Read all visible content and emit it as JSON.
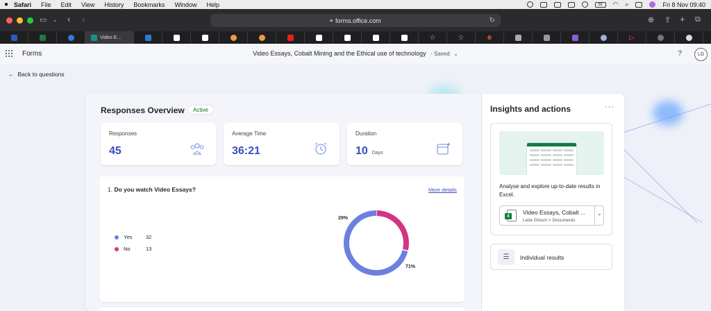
{
  "menubar": {
    "apple": "",
    "items": [
      "Safari",
      "File",
      "Edit",
      "View",
      "History",
      "Bookmarks",
      "Window",
      "Help"
    ],
    "datetime": "Fri 8 Nov 09:40",
    "battery": "50"
  },
  "browser": {
    "url": "forms.office.com",
    "active_tab_title": "Video E..."
  },
  "app": {
    "name": "Forms",
    "title": "Video Essays, Cobalt Mining and the Ethical use of technology",
    "saved": "- Saved",
    "help": "?",
    "avatar": "LG"
  },
  "nav": {
    "back_label": "Back to questions"
  },
  "overview": {
    "title": "Responses Overview",
    "status": "Active",
    "stats": [
      {
        "label": "Responses",
        "value": "45",
        "unit": ""
      },
      {
        "label": "Average Time",
        "value": "36:21",
        "unit": ""
      },
      {
        "label": "Duration",
        "value": "10",
        "unit": "Days"
      }
    ]
  },
  "question": {
    "number": "1.",
    "text": "Do you watch Video Essays?",
    "more_details": "More details",
    "options": [
      {
        "name": "Yes",
        "count": "32",
        "color": "#6b80e0"
      },
      {
        "name": "No",
        "count": "13",
        "color": "#d63384"
      }
    ]
  },
  "chart_data": {
    "type": "pie",
    "categories": [
      "Yes",
      "No"
    ],
    "values": [
      32,
      13
    ],
    "percent_labels": [
      "71%",
      "29%"
    ],
    "colors": [
      "#6b80e0",
      "#d63384"
    ],
    "style": "donut"
  },
  "insights": {
    "title": "Insights and actions",
    "more": "···",
    "excel_desc": "Analyse and explore up-to-date results in Excel.",
    "file_name": "Video Essays, Cobalt ...",
    "file_path": "Leila Ghouri > Documents",
    "individual_results": "Individual results"
  },
  "colors": {
    "accent": "#3b4cc0",
    "yes": "#6b80e0",
    "no": "#d63384",
    "excel_green": "#107c41"
  }
}
